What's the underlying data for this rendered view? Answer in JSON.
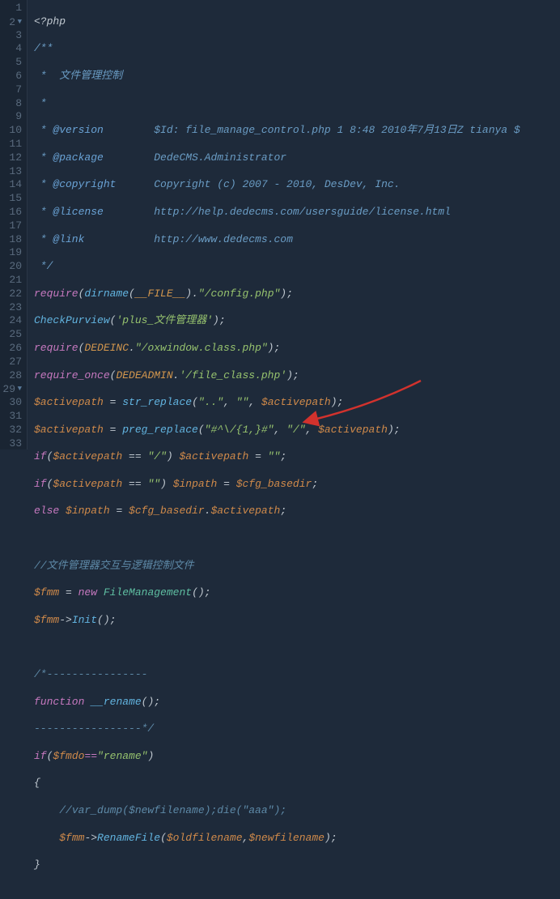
{
  "chart_data": null,
  "lines": [
    {
      "n": 1
    },
    {
      "n": 2,
      "fold": true
    },
    {
      "n": 3
    },
    {
      "n": 4
    },
    {
      "n": 5
    },
    {
      "n": 6
    },
    {
      "n": 7
    },
    {
      "n": 8
    },
    {
      "n": 9
    },
    {
      "n": 10
    },
    {
      "n": 11
    },
    {
      "n": 12
    },
    {
      "n": 13
    },
    {
      "n": 14
    },
    {
      "n": 15
    },
    {
      "n": 16
    },
    {
      "n": 17
    },
    {
      "n": 18
    },
    {
      "n": 19
    },
    {
      "n": 20
    },
    {
      "n": 21
    },
    {
      "n": 22
    },
    {
      "n": 23
    },
    {
      "n": 24
    },
    {
      "n": 25
    },
    {
      "n": 26
    },
    {
      "n": 27
    },
    {
      "n": 28
    },
    {
      "n": 29,
      "fold": true
    },
    {
      "n": 30
    },
    {
      "n": 31
    },
    {
      "n": 32
    },
    {
      "n": 33
    }
  ],
  "c": {
    "l1_open": "<?php",
    "l2": "/**",
    "l3_a": " *  ",
    "l3_b": "文件管理控制",
    "l4": " *",
    "l5_a": " * ",
    "l5_b": "@version",
    "l5_c": "        $Id: file_manage_control.php 1 8:48 2010年7月13日Z tianya $",
    "l6_a": " * ",
    "l6_b": "@package",
    "l6_c": "        DedeCMS.Administrator",
    "l7_a": " * ",
    "l7_b": "@copyright",
    "l7_c": "      Copyright (c) 2007 - 2010, DesDev, Inc.",
    "l8_a": " * ",
    "l8_b": "@license",
    "l8_c": "        http://help.dedecms.com/usersguide/license.html",
    "l9_a": " * ",
    "l9_b": "@link",
    "l9_c": "           http://www.dedecms.com",
    "l10": " */",
    "l11_a": "require",
    "l11_b": "(",
    "l11_c": "dirname",
    "l11_d": "(",
    "l11_e": "__FILE__",
    "l11_f": ").",
    "l11_g": "\"/config.php\"",
    "l11_h": ");",
    "l12_a": "CheckPurview",
    "l12_b": "(",
    "l12_c": "'plus_文件管理器'",
    "l12_d": ");",
    "l13_a": "require",
    "l13_b": "(",
    "l13_c": "DEDEINC",
    "l13_d": ".",
    "l13_e": "\"/oxwindow.class.php\"",
    "l13_f": ");",
    "l14_a": "require_once",
    "l14_b": "(",
    "l14_c": "DEDEADMIN",
    "l14_d": ".",
    "l14_e": "'/file_class.php'",
    "l14_f": ");",
    "l15_a": "$activepath",
    "l15_b": " = ",
    "l15_c": "str_replace",
    "l15_d": "(",
    "l15_e": "\"..\"",
    "l15_f": ", ",
    "l15_g": "\"\"",
    "l15_h": ", ",
    "l15_i": "$activepath",
    "l15_j": ");",
    "l16_a": "$activepath",
    "l16_b": " = ",
    "l16_c": "preg_replace",
    "l16_d": "(",
    "l16_e": "\"#^\\/{1,}#\"",
    "l16_f": ", ",
    "l16_g": "\"/\"",
    "l16_h": ", ",
    "l16_i": "$activepath",
    "l16_j": ");",
    "l17_a": "if",
    "l17_b": "(",
    "l17_c": "$activepath",
    "l17_d": " == ",
    "l17_e": "\"/\"",
    "l17_f": ") ",
    "l17_g": "$activepath",
    "l17_h": " = ",
    "l17_i": "\"\"",
    "l17_j": ";",
    "l18_a": "if",
    "l18_b": "(",
    "l18_c": "$activepath",
    "l18_d": " == ",
    "l18_e": "\"\"",
    "l18_f": ") ",
    "l18_g": "$inpath",
    "l18_h": " = ",
    "l18_i": "$cfg_basedir",
    "l18_j": ";",
    "l19_a": "else",
    "l19_b": " ",
    "l19_c": "$inpath",
    "l19_d": " = ",
    "l19_e": "$cfg_basedir",
    "l19_f": ".",
    "l19_g": "$activepath",
    "l19_h": ";",
    "l21": "//文件管理器交互与逻辑控制文件",
    "l22_a": "$fmm",
    "l22_b": " = ",
    "l22_c": "new",
    "l22_d": " ",
    "l22_e": "FileManagement",
    "l22_f": "();",
    "l23_a": "$fmm",
    "l23_b": "->",
    "l23_c": "Init",
    "l23_d": "();",
    "l25": "/*----------------",
    "l26_a": "function",
    "l26_b": " ",
    "l26_c": "__rename",
    "l26_d": "();",
    "l27": "-----------------*/",
    "l28_a": "if",
    "l28_b": "(",
    "l28_c": "$fmdo",
    "l28_d": "==",
    "l28_e": "\"rename\"",
    "l28_f": ")",
    "l29": "{",
    "l30_a": "    ",
    "l30_b": "//var_dump($newfilename);die(\"aaa\");",
    "l31_a": "    ",
    "l31_b": "$fmm",
    "l31_c": "->",
    "l31_d": "RenameFile",
    "l31_e": "(",
    "l31_f": "$oldfilename",
    "l31_g": ",",
    "l31_h": "$newfilename",
    "l31_i": ");",
    "l32": "}"
  },
  "arrow_color": "#d2322d"
}
